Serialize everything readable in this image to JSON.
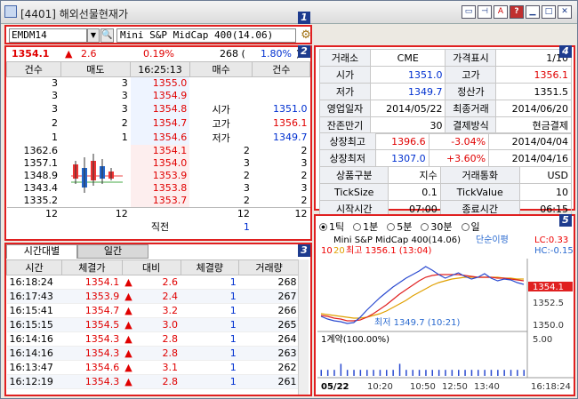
{
  "window": {
    "title": "[4401] 해외선물현재가"
  },
  "toolbar": {
    "code": "EMDM14",
    "name": "Mini S&P MidCap 400(14.06)"
  },
  "panel_tags": [
    "1",
    "2",
    "3",
    "4",
    "5"
  ],
  "quote": {
    "price": "1354.1",
    "arrow": "▲",
    "change": "2.6",
    "pct": "0.19%",
    "volume": "268 (",
    "vol_pct": "1.80%",
    "vol_close": ")"
  },
  "orderbook": {
    "headers": [
      "건수",
      "매도",
      "16:25:13",
      "매수",
      "건수"
    ],
    "asks": [
      {
        "cnt": "3",
        "qty": "3",
        "price": "1355.0"
      },
      {
        "cnt": "3",
        "qty": "3",
        "price": "1354.9"
      },
      {
        "cnt": "3",
        "qty": "3",
        "price": "1354.8"
      },
      {
        "cnt": "2",
        "qty": "2",
        "price": "1354.7"
      },
      {
        "cnt": "1",
        "qty": "1",
        "price": "1354.6"
      }
    ],
    "ohl": [
      {
        "label": "",
        "value": ""
      },
      {
        "label": "",
        "value": ""
      },
      {
        "label": "시가",
        "value": "1351.0"
      },
      {
        "label": "고가",
        "value": "1356.1"
      },
      {
        "label": "저가",
        "value": "1349.7"
      }
    ],
    "candle_prices": [
      "1362.6",
      "1357.1",
      "1348.9",
      "1343.4",
      "1335.2"
    ],
    "bids": [
      {
        "price": "1354.1",
        "qty": "2",
        "cnt": "2"
      },
      {
        "price": "1354.0",
        "qty": "3",
        "cnt": "3"
      },
      {
        "price": "1353.9",
        "qty": "2",
        "cnt": "2"
      },
      {
        "price": "1353.8",
        "qty": "3",
        "cnt": "3"
      },
      {
        "price": "1353.7",
        "qty": "2",
        "cnt": "2"
      }
    ],
    "totals": {
      "ask_cnt": "12",
      "ask_qty": "12",
      "bid_qty": "12",
      "bid_cnt": "12"
    },
    "last": {
      "label": "직전",
      "value": "1"
    }
  },
  "trades": {
    "tabs": [
      "시간대별",
      "일간"
    ],
    "headers": [
      "시간",
      "체결가",
      "대비",
      "체결량",
      "거래량"
    ],
    "rows": [
      {
        "time": "16:18:24",
        "price": "1354.1",
        "chg": "2.6",
        "qty": "1",
        "vol": "268"
      },
      {
        "time": "16:17:43",
        "price": "1353.9",
        "chg": "2.4",
        "qty": "1",
        "vol": "267"
      },
      {
        "time": "16:15:41",
        "price": "1354.7",
        "chg": "3.2",
        "qty": "1",
        "vol": "266"
      },
      {
        "time": "16:15:15",
        "price": "1354.5",
        "chg": "3.0",
        "qty": "1",
        "vol": "265"
      },
      {
        "time": "16:14:16",
        "price": "1354.3",
        "chg": "2.8",
        "qty": "1",
        "vol": "264"
      },
      {
        "time": "16:14:16",
        "price": "1354.3",
        "chg": "2.8",
        "qty": "1",
        "vol": "263"
      },
      {
        "time": "16:13:47",
        "price": "1354.6",
        "chg": "3.1",
        "qty": "1",
        "vol": "262"
      },
      {
        "time": "16:12:19",
        "price": "1354.3",
        "chg": "2.8",
        "qty": "1",
        "vol": "261"
      }
    ]
  },
  "info": {
    "rows1": [
      [
        "거래소",
        "CME",
        "가격표시",
        "1/10"
      ],
      [
        "시가",
        "1351.0",
        "고가",
        "1356.1"
      ],
      [
        "저가",
        "1349.7",
        "정산가",
        "1351.5"
      ],
      [
        "영업일자",
        "2014/05/22",
        "최종거래",
        "2014/06/20"
      ],
      [
        "잔존만기",
        "30",
        "결제방식",
        "현금결제"
      ]
    ],
    "rows2": [
      [
        "상장최고",
        "1396.6",
        "-3.04%",
        "2014/04/04"
      ],
      [
        "상장최저",
        "1307.0",
        "+3.60%",
        "2014/04/16"
      ]
    ],
    "rows3": [
      [
        "상품구분",
        "지수",
        "거래통화",
        "USD"
      ],
      [
        "TickSize",
        "0.1",
        "TickValue",
        "10"
      ],
      [
        "시작시간",
        "07:00",
        "종료시간",
        "06:15"
      ]
    ]
  },
  "chart": {
    "periods": [
      "1틱",
      "1분",
      "5분",
      "30분",
      "일"
    ],
    "selected_period": "1틱",
    "title": "Mini S&P MidCap 400(14.06)",
    "ma_labels": [
      "10",
      "20"
    ],
    "high_note": "최고 1356.1 (13:04)",
    "low_note": "최저 1349.7 (10:21)",
    "mode": "단순이평",
    "lc": "LC:0.33",
    "hc": "HC:-0.15",
    "price_ticks": [
      "1354.1",
      "1352.5",
      "1350.0"
    ],
    "volume_label": "1계약(100.00%)",
    "volume_tick": "5.00",
    "x_ticks": [
      "05/22",
      "10:20",
      "10:50",
      "12:50",
      "13:40"
    ],
    "x_end": "16:18:24",
    "series": {
      "price": [
        1350.5,
        1350.2,
        1350.0,
        1349.9,
        1349.7,
        1349.8,
        1350.4,
        1351.2,
        1351.9,
        1352.6,
        1353.2,
        1353.8,
        1354.3,
        1354.8,
        1355.2,
        1355.6,
        1356.1,
        1355.7,
        1355.2,
        1354.8,
        1355.1,
        1355.4,
        1355.0,
        1354.7,
        1354.9,
        1355.3,
        1354.8,
        1354.5,
        1354.7,
        1354.6,
        1354.3,
        1354.1
      ],
      "ma10": [
        1350.6,
        1350.5,
        1350.3,
        1350.2,
        1350.0,
        1350.0,
        1350.1,
        1350.4,
        1350.8,
        1351.3,
        1351.8,
        1352.4,
        1353.0,
        1353.5,
        1354.0,
        1354.5,
        1354.9,
        1355.1,
        1355.2,
        1355.2,
        1355.2,
        1355.2,
        1355.1,
        1355.0,
        1354.9,
        1354.9,
        1354.9,
        1354.8,
        1354.8,
        1354.7,
        1354.6,
        1354.5
      ],
      "ma20": [
        1350.8,
        1350.7,
        1350.6,
        1350.5,
        1350.4,
        1350.3,
        1350.3,
        1350.4,
        1350.6,
        1350.8,
        1351.1,
        1351.5,
        1351.9,
        1352.3,
        1352.8,
        1353.2,
        1353.6,
        1354.0,
        1354.3,
        1354.5,
        1354.7,
        1354.8,
        1354.9,
        1354.9,
        1354.9,
        1354.9,
        1354.9,
        1354.9,
        1354.8,
        1354.8,
        1354.7,
        1354.7
      ],
      "volume": [
        1,
        1,
        1,
        2,
        1,
        1,
        1,
        1,
        1,
        1,
        1,
        1,
        2,
        1,
        1,
        1,
        1,
        1,
        1,
        1,
        1,
        1,
        1,
        1,
        1,
        1,
        1,
        1,
        1,
        1,
        1,
        1
      ]
    }
  }
}
